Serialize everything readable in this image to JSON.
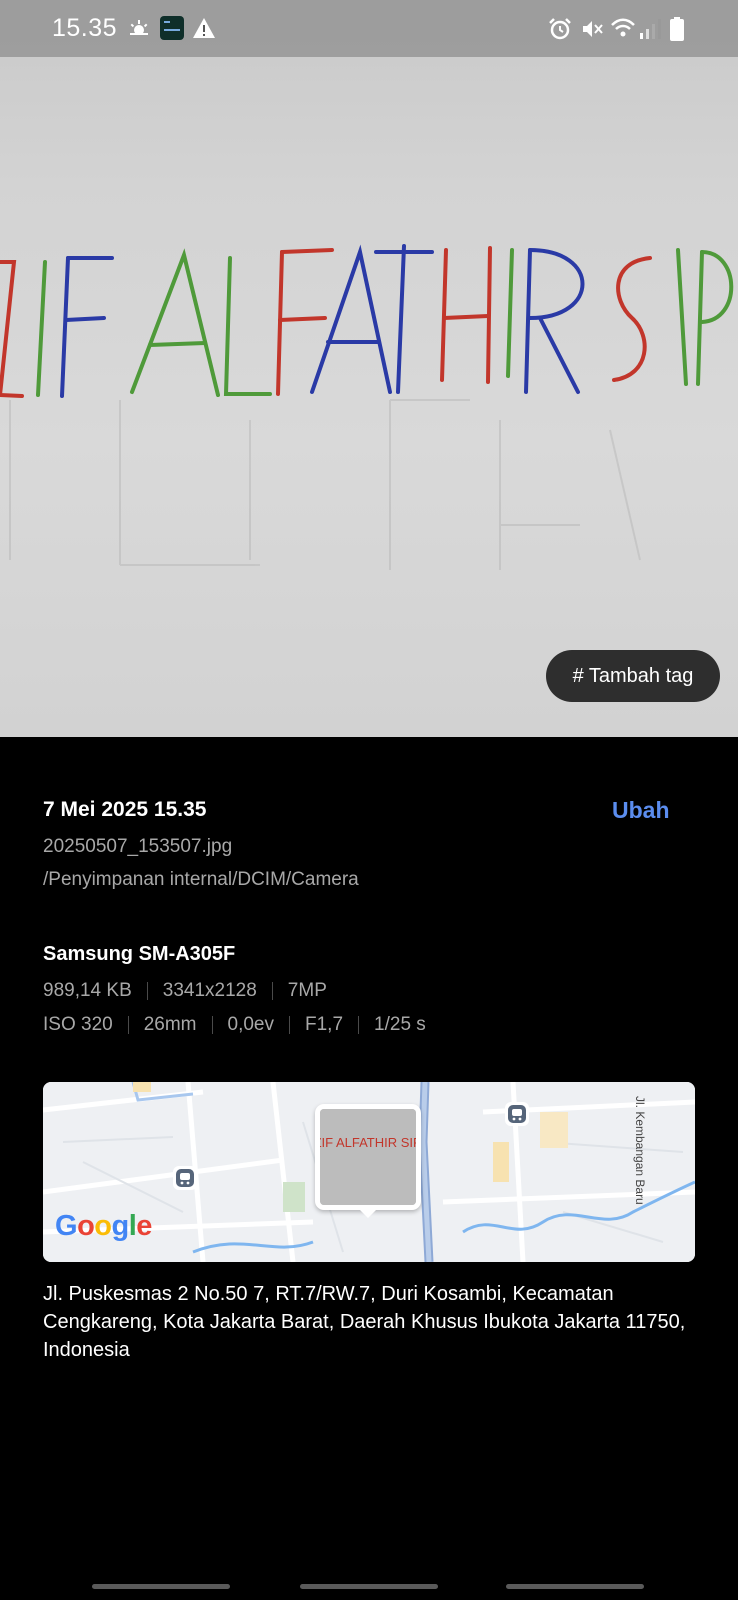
{
  "status_bar": {
    "time": "15.35",
    "left_icons": [
      "weather-sunrise-icon",
      "app-notification-icon",
      "warning-icon"
    ],
    "right_icons": [
      "alarm-icon",
      "mute-icon",
      "wifi-icon",
      "signal-icon",
      "battery-icon"
    ]
  },
  "photo": {
    "handwriting_text": "ZIF ALFATHIR SIR",
    "tag_button_label": "# Tambah tag"
  },
  "details": {
    "date_time": "7 Mei 2025 15.35",
    "edit_label": "Ubah",
    "file_name": "20250507_153507.jpg",
    "file_path": "/Penyimpanan internal/DCIM/Camera",
    "device": "Samsung SM-A305F",
    "specs_row1": [
      "989,14 KB",
      "3341x2128",
      "7MP"
    ],
    "specs_row2": [
      "ISO 320",
      "26mm",
      "0,0ev",
      "F1,7",
      "1/25 s"
    ]
  },
  "map": {
    "street_label": "Jl. Kembangan Baru",
    "logo": "Google",
    "logo_colors": [
      "#4285F4",
      "#EA4335",
      "#FBBC05",
      "#4285F4",
      "#34A853",
      "#EA4335"
    ],
    "thumbnail_text": "ZIF ALFATHIR SIR"
  },
  "address": "Jl. Puskesmas 2 No.50 7, RT.7/RW.7, Duri Kosambi, Kecamatan Cengkareng, Kota Jakarta Barat, Daerah Khusus Ibukota Jakarta 11750, Indonesia",
  "colors": {
    "accent": "#5b8def",
    "ink_red": "#c2362b",
    "ink_blue": "#2a3aa6",
    "ink_green": "#4f9a3a"
  }
}
